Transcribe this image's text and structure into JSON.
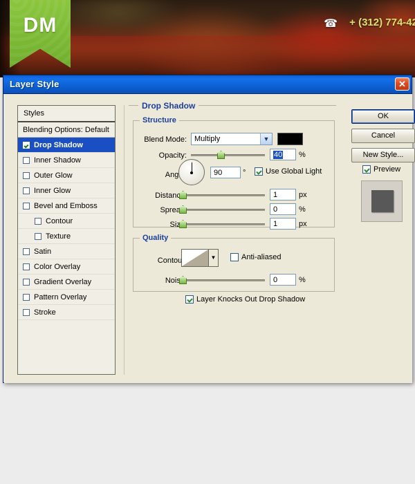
{
  "banner": {
    "logo_text": "DM",
    "phone_icon": "phone-icon",
    "phone_number": "+ (312) 774-42"
  },
  "dialog": {
    "title": "Layer Style",
    "close_label": "✕"
  },
  "styles_panel": {
    "header": "Styles",
    "items": [
      {
        "label": "Blending Options: Default",
        "checkbox": false,
        "has_checkbox": false,
        "selected": false,
        "indent": false
      },
      {
        "label": "Drop Shadow",
        "checkbox": true,
        "has_checkbox": true,
        "selected": true,
        "indent": false
      },
      {
        "label": "Inner Shadow",
        "checkbox": false,
        "has_checkbox": true,
        "selected": false,
        "indent": false
      },
      {
        "label": "Outer Glow",
        "checkbox": false,
        "has_checkbox": true,
        "selected": false,
        "indent": false
      },
      {
        "label": "Inner Glow",
        "checkbox": false,
        "has_checkbox": true,
        "selected": false,
        "indent": false
      },
      {
        "label": "Bevel and Emboss",
        "checkbox": false,
        "has_checkbox": true,
        "selected": false,
        "indent": false
      },
      {
        "label": "Contour",
        "checkbox": false,
        "has_checkbox": true,
        "selected": false,
        "indent": true
      },
      {
        "label": "Texture",
        "checkbox": false,
        "has_checkbox": true,
        "selected": false,
        "indent": true
      },
      {
        "label": "Satin",
        "checkbox": false,
        "has_checkbox": true,
        "selected": false,
        "indent": false
      },
      {
        "label": "Color Overlay",
        "checkbox": false,
        "has_checkbox": true,
        "selected": false,
        "indent": false
      },
      {
        "label": "Gradient Overlay",
        "checkbox": false,
        "has_checkbox": true,
        "selected": false,
        "indent": false
      },
      {
        "label": "Pattern Overlay",
        "checkbox": false,
        "has_checkbox": true,
        "selected": false,
        "indent": false
      },
      {
        "label": "Stroke",
        "checkbox": false,
        "has_checkbox": true,
        "selected": false,
        "indent": false
      }
    ]
  },
  "panel": {
    "section_title": "Drop Shadow",
    "structure": {
      "legend": "Structure",
      "blend_mode_label": "Blend Mode:",
      "blend_mode_value": "Multiply",
      "blend_color": "#000000",
      "opacity_label": "Opacity:",
      "opacity_value": "40",
      "opacity_unit": "%",
      "angle_label": "Angle:",
      "angle_value": "90",
      "angle_unit": "°",
      "use_global_light": "Use Global Light",
      "use_global_light_checked": true,
      "distance_label": "Distance:",
      "distance_value": "1",
      "distance_unit": "px",
      "spread_label": "Spread:",
      "spread_value": "0",
      "spread_unit": "%",
      "size_label": "Size:",
      "size_value": "1",
      "size_unit": "px"
    },
    "quality": {
      "legend": "Quality",
      "contour_label": "Contour:",
      "anti_aliased_label": "Anti-aliased",
      "anti_aliased_checked": false,
      "noise_label": "Noise:",
      "noise_value": "0",
      "noise_unit": "%",
      "knockout_label": "Layer Knocks Out Drop Shadow",
      "knockout_checked": true
    }
  },
  "actions": {
    "ok": "OK",
    "cancel": "Cancel",
    "new_style": "New Style...",
    "preview_label": "Preview",
    "preview_checked": true
  },
  "colors": {
    "titlebar_blue": "#0e63d8",
    "selection_blue": "#1a4fc4",
    "legend_blue": "#1a3fa0",
    "logo_green": "#7cba35",
    "phone_yellow": "#d8e26a"
  }
}
